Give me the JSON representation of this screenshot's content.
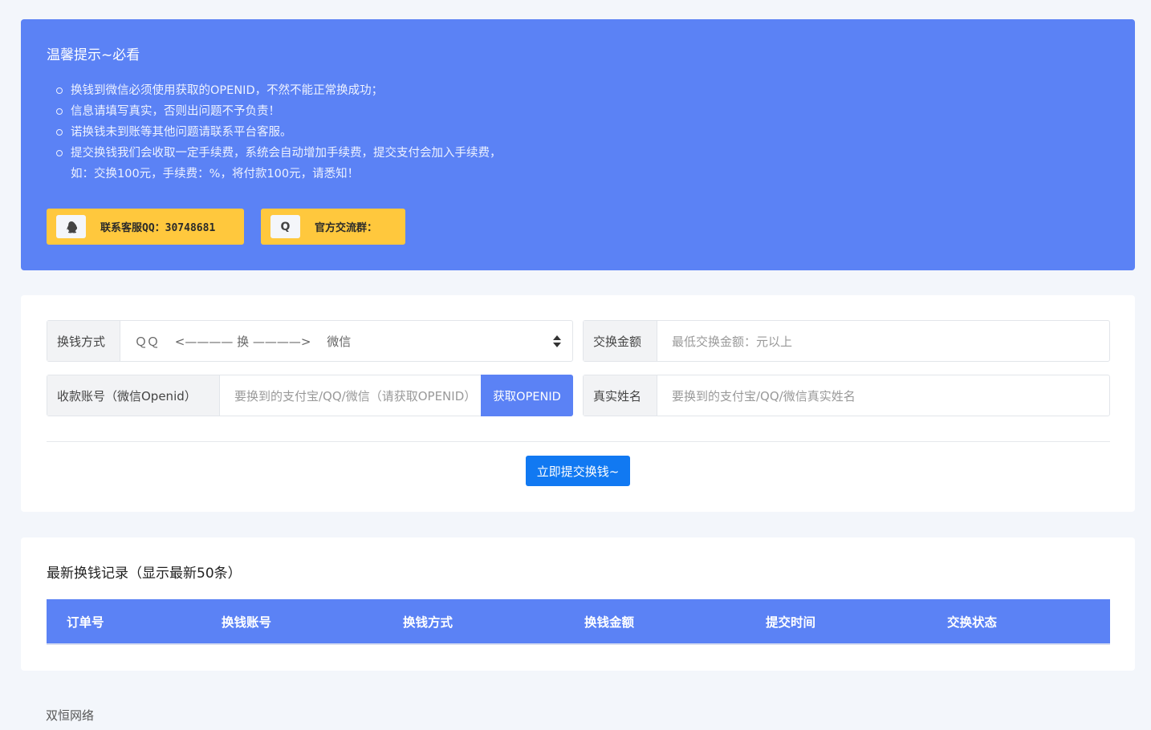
{
  "notice": {
    "title": "温馨提示~必看",
    "items": [
      "换钱到微信必须使用获取的OPENID，不然不能正常换成功；",
      "信息请填写真实，否则出问题不予负责！",
      "诺换钱未到账等其他问题请联系平台客服。",
      "提交换钱我们会收取一定手续费，系统会自动增加手续费，提交支付会加入手续费，",
      "如：交换100元，手续费：%，将付款100元，请悉知！"
    ],
    "contact_qq": "联系客服QQ：30748681",
    "official_group": "官方交流群："
  },
  "form": {
    "method_label": "换钱方式",
    "method_value": "ＱＱ　 <———— 换 ————>　 微信",
    "amount_label": "交换金额",
    "amount_placeholder": "最低交换金额：元以上",
    "account_label": "收款账号（微信Openid）",
    "account_placeholder": "要换到的支付宝/QQ/微信（请获取OPENID）",
    "get_openid": "获取OPENID",
    "name_label": "真实姓名",
    "name_placeholder": "要换到的支付宝/QQ/微信真实姓名",
    "submit": "立即提交换钱~"
  },
  "records": {
    "title": "最新换钱记录（显示最新50条）",
    "columns": [
      "订单号",
      "换钱账号",
      "换钱方式",
      "换钱金额",
      "提交时间",
      "交换状态"
    ]
  },
  "footer": "双恒网络",
  "icons": {
    "qq": "penguin-icon",
    "group": "q-icon"
  },
  "colors": {
    "primary": "#5b82f5",
    "accent": "#ffc83d",
    "submit": "#1179f2"
  }
}
